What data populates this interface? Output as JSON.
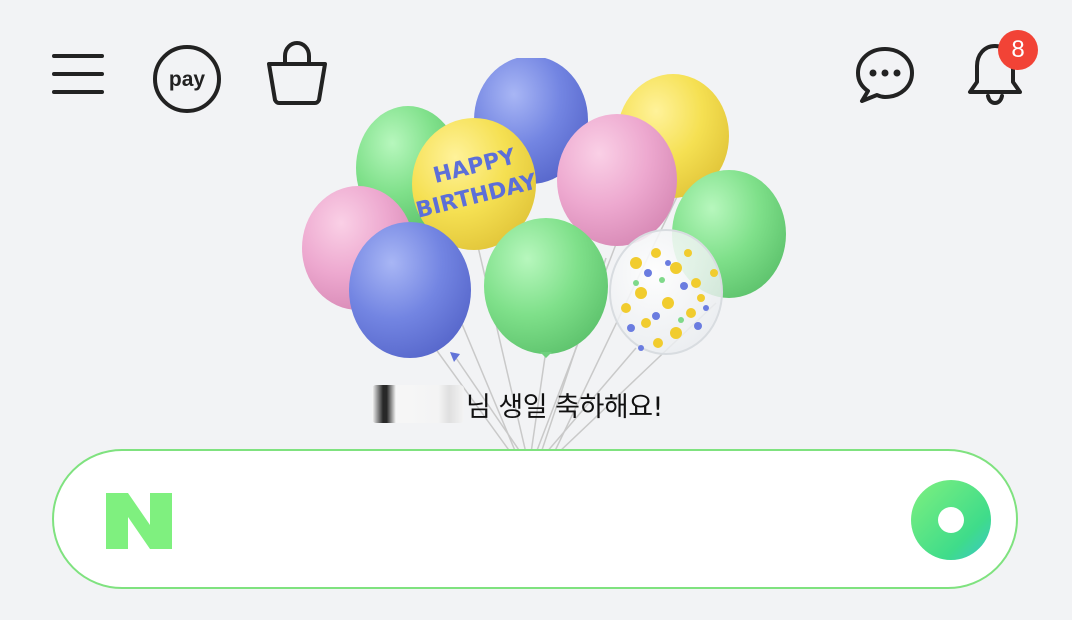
{
  "header": {
    "left_icons": [
      "menu-icon",
      "pay-icon",
      "shopping-bag-icon"
    ],
    "pay_label": "pay",
    "right_icons": [
      "chat-icon",
      "bell-icon"
    ],
    "notification_count": "8"
  },
  "banner": {
    "image": "birthday-balloons",
    "balloon_text_1": "HAPPY",
    "balloon_text_2": "BIRTHDAY",
    "greeting": "님 생일 축하해요!"
  },
  "search": {
    "logo_letter": "N",
    "placeholder": "",
    "value": "",
    "voice_button_icon": "green-dot-icon"
  },
  "colors": {
    "accent_green": "#03c75a",
    "logo_green": "#7ff07f",
    "badge_red": "#f24336",
    "background": "#f2f3f5"
  }
}
